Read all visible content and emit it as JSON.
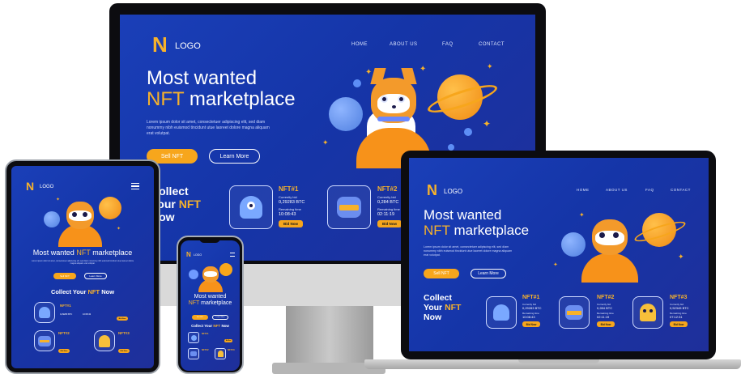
{
  "brand": {
    "logo_letter": "N",
    "logo_text": "LOGO"
  },
  "nav": {
    "home": "HOME",
    "about": "ABOUT US",
    "faq": "FAQ",
    "contact": "CONTACT"
  },
  "hero": {
    "title_line1": "Most wanted",
    "title_accent": "NFT",
    "title_rest": "marketplace",
    "body": "Lorem ipsum dolor sit amet, consectetuer adipiscing elit, sed diam nonummy nibh euismod tincidunt utue laoreet dolore magna aliquam erat volutpat.",
    "sell_btn": "Sell NFT",
    "learn_btn": "Learn More"
  },
  "collect": {
    "line1": "Collect",
    "line2_prefix": "Your",
    "line2_accent": "NFT",
    "line3": "Now"
  },
  "collect_inline": {
    "prefix": "Collect Your",
    "accent": "NFT",
    "suffix": "Now"
  },
  "cards": [
    {
      "title": "NFT#1",
      "price_label": "Currently bid",
      "price": "0,29283 BTC",
      "time_label": "Remaining time",
      "time": "10:08:43",
      "bid": "Bid Now"
    },
    {
      "title": "NFT#2",
      "price_label": "Currently bid",
      "price": "0,284 BTC",
      "time_label": "Remaining time",
      "time": "02:11:19",
      "bid": "Bid Now"
    },
    {
      "title": "NFT#3",
      "price_label": "Currently bid",
      "price": "0,52345 BTC",
      "time_label": "Remaining time",
      "time": "07:12:31",
      "bid": "Bid Now"
    }
  ],
  "colors": {
    "site_blue": "#1a3fb8",
    "accent": "#f7b22b",
    "button": "#f7a61c"
  },
  "icons": [
    "hamburger-menu-icon",
    "fox-astronaut-illustration",
    "planet-icon",
    "star-icon",
    "blue-monster-nft-icon",
    "horned-visor-nft-icon",
    "yellow-ghost-nft-icon"
  ]
}
